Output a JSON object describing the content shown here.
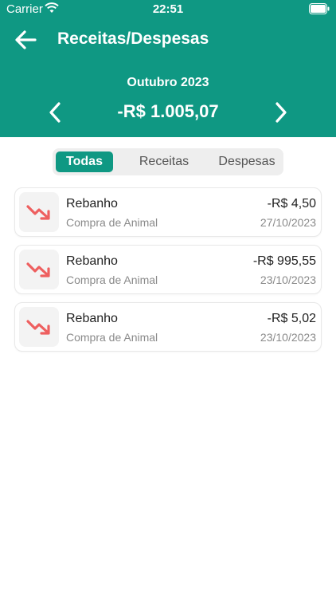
{
  "status_bar": {
    "carrier": "Carrier",
    "time": "22:51"
  },
  "header": {
    "title": "Receitas/Despesas",
    "month": "Outubro 2023",
    "balance": "-R$ 1.005,07",
    "color": "#0f9883"
  },
  "filter": {
    "options": [
      "Todas",
      "Receitas",
      "Despesas"
    ],
    "selected": "Todas"
  },
  "transactions": [
    {
      "title": "Rebanho",
      "category": "Compra de Animal",
      "amount": "-R$ 4,50",
      "date": "27/10/2023",
      "icon": "trending-down-icon"
    },
    {
      "title": "Rebanho",
      "category": "Compra de Animal",
      "amount": "-R$ 995,55",
      "date": "23/10/2023",
      "icon": "trending-down-icon"
    },
    {
      "title": "Rebanho",
      "category": "Compra de Animal",
      "amount": "-R$ 5,02",
      "date": "23/10/2023",
      "icon": "trending-down-icon"
    }
  ],
  "colors": {
    "expense_icon": "#ee5f5f",
    "accent": "#0f9883"
  }
}
